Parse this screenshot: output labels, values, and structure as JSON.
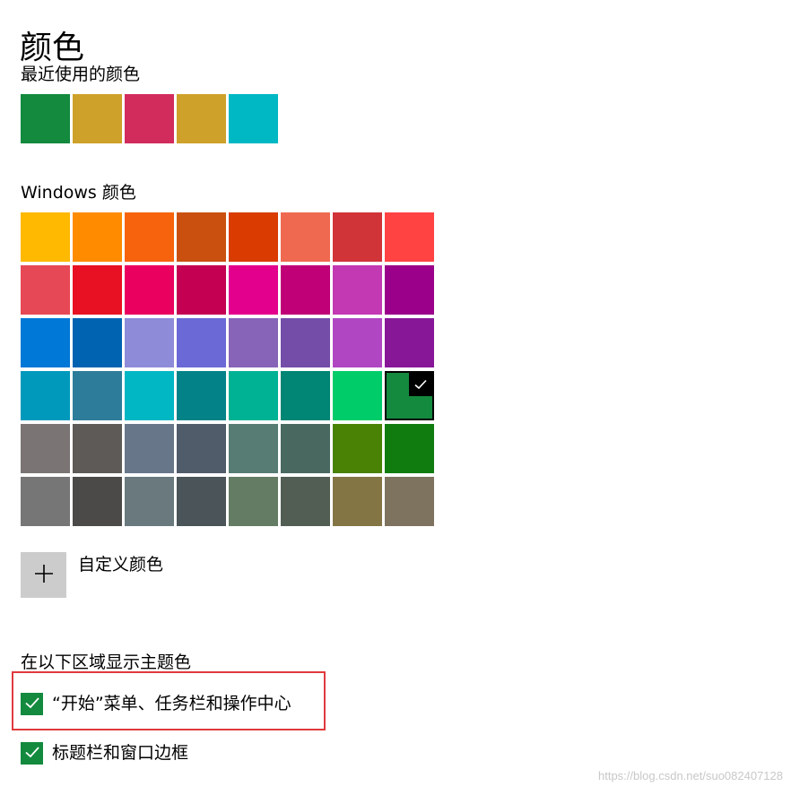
{
  "page": {
    "title": "颜色"
  },
  "recent": {
    "label": "最近使用的颜色",
    "colors": [
      "#138a3e",
      "#cea12a",
      "#d22c5c",
      "#cea12a",
      "#00b8c4"
    ]
  },
  "windows_colors": {
    "label": "Windows 颜色",
    "selected_index": 31,
    "colors": [
      "#ffb900",
      "#ff8c00",
      "#f7630c",
      "#ca5010",
      "#da3b01",
      "#ef6950",
      "#d13438",
      "#ff4343",
      "#e74856",
      "#e81123",
      "#ea005e",
      "#c30052",
      "#e3008c",
      "#bf0077",
      "#c239b3",
      "#9a0089",
      "#0078d7",
      "#0063b1",
      "#8e8cd8",
      "#6b69d6",
      "#8764b8",
      "#744da9",
      "#b146c2",
      "#881798",
      "#0099bc",
      "#2d7d9a",
      "#00b7c3",
      "#038387",
      "#00b294",
      "#018574",
      "#00cc6a",
      "#138a3e",
      "#7a7574",
      "#5d5a58",
      "#68768a",
      "#515c6b",
      "#567c73",
      "#486860",
      "#498205",
      "#107c10",
      "#767676",
      "#4c4a48",
      "#69797e",
      "#4a5459",
      "#647c64",
      "#525e54",
      "#847545",
      "#7e735f"
    ]
  },
  "custom": {
    "label": "自定义颜色",
    "icon": "plus-icon"
  },
  "accent_surfaces": {
    "label": "在以下区域显示主题色",
    "options": [
      {
        "label": "“开始”菜单、任务栏和操作中心",
        "checked": true
      },
      {
        "label": "标题栏和窗口边框",
        "checked": true
      }
    ]
  },
  "theme": {
    "accent": "#138a3e",
    "highlight_border": "#e03a3e",
    "button_gray": "#cccccc"
  },
  "watermark": "https://blog.csdn.net/suo082407128"
}
